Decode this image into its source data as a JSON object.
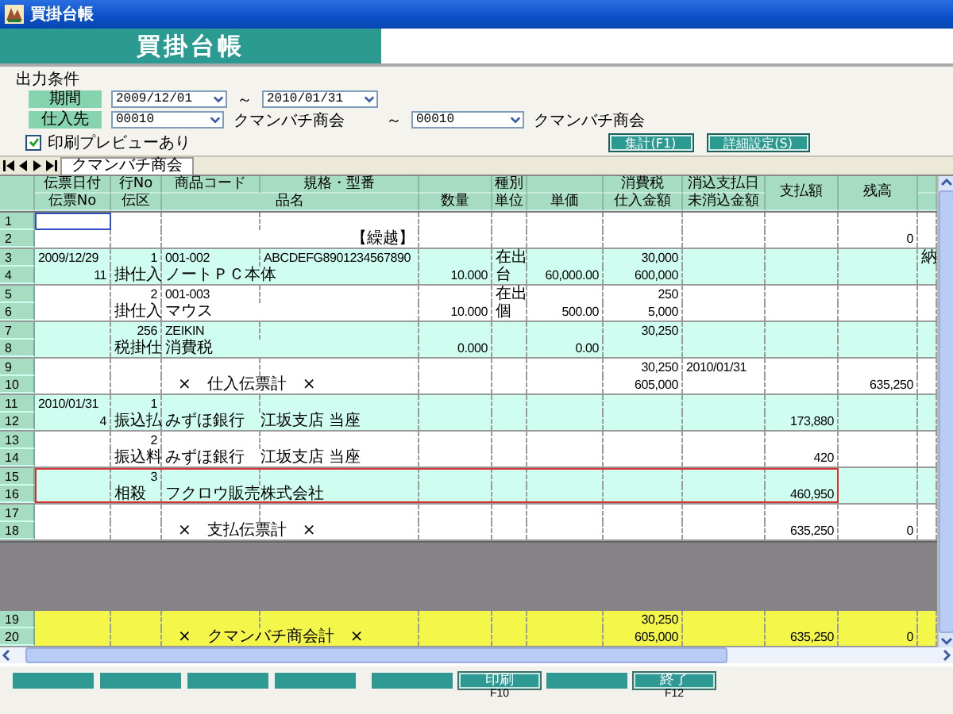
{
  "window": {
    "title": "買掛台帳"
  },
  "header": {
    "title": "買掛台帳"
  },
  "conditions": {
    "title": "出力条件",
    "period": {
      "label": "期間",
      "from": "2009/12/01",
      "separator": "～",
      "to": "2010/01/31"
    },
    "supplier": {
      "label": "仕入先",
      "from_code": "00010",
      "from_name": "クマンバチ商会",
      "separator": "～",
      "to_code": "00010",
      "to_name": "クマンバチ商会"
    },
    "preview": {
      "label": "印刷プレビューあり",
      "checked": true
    },
    "buttons": [
      "集計(F1)",
      "詳細設定(S)"
    ]
  },
  "tabs": [
    {
      "label": "クマンバチ商会",
      "selected": true
    }
  ],
  "table": {
    "header_top": {
      "date": "伝票日付",
      "line_no": "行No",
      "code": "商品コード",
      "spec": "規格・型番",
      "kind": "種別",
      "tax": "消費税",
      "pay_date": "消込支払日",
      "payment": "支払額",
      "balance": "残高"
    },
    "header_bottom": {
      "slip_no": "伝票No",
      "category": "伝区",
      "name": "品名",
      "quantity": "数量",
      "unit": "単位",
      "unit_price": "単価",
      "purchase_amount": "仕入金額",
      "unreconciled": "未消込金額"
    },
    "records": [
      {
        "kind": "carryover",
        "rows": [
          "1",
          "2"
        ],
        "cursor": true,
        "selected": false,
        "bottom": {
          "name": "【繰越】",
          "balance": "0"
        }
      },
      {
        "kind": "item",
        "rows": [
          "3",
          "4"
        ],
        "cursor": false,
        "selected": false,
        "top": {
          "date": "2009/12/29",
          "line_no": "1",
          "code": "001-002",
          "spec": "ABCDEFG8901234567890",
          "kind": "在出",
          "tax": "30,000",
          "extra": "納"
        },
        "bottom": {
          "slip_no": "11",
          "category": "掛仕入",
          "name": "ノートＰＣ本体",
          "quantity": "10.000",
          "unit": "台",
          "unit_price": "60,000.00",
          "purchase_amount": "600,000"
        }
      },
      {
        "kind": "item",
        "rows": [
          "5",
          "6"
        ],
        "cursor": false,
        "selected": false,
        "top": {
          "line_no": "2",
          "code": "001-003",
          "kind": "在出",
          "tax": "250"
        },
        "bottom": {
          "category": "掛仕入",
          "name": "マウス",
          "quantity": "10.000",
          "unit": "個",
          "unit_price": "500.00",
          "purchase_amount": "5,000"
        }
      },
      {
        "kind": "item",
        "rows": [
          "7",
          "8"
        ],
        "cursor": false,
        "selected": false,
        "top": {
          "line_no": "256",
          "code": "ZEIKIN",
          "tax": "30,250"
        },
        "bottom": {
          "category": "税掛仕",
          "name": "消費税",
          "quantity": "0.000",
          "unit_price": "0.00"
        }
      },
      {
        "kind": "subtotal",
        "rows": [
          "9",
          "10"
        ],
        "cursor": false,
        "selected": false,
        "top": {
          "tax": "30,250",
          "pay_date": "2010/01/31"
        },
        "bottom": {
          "name": "×　仕入伝票計　×",
          "purchase_amount": "605,000",
          "balance": "635,250"
        }
      },
      {
        "kind": "item",
        "rows": [
          "11",
          "12"
        ],
        "cursor": false,
        "selected": false,
        "top": {
          "date": "2010/01/31",
          "line_no": "1"
        },
        "bottom": {
          "slip_no": "4",
          "category": "振込払",
          "name": "みずほ銀行　江坂支店 当座",
          "payment": "173,880"
        }
      },
      {
        "kind": "item",
        "rows": [
          "13",
          "14"
        ],
        "cursor": false,
        "selected": false,
        "top": {
          "line_no": "2"
        },
        "bottom": {
          "category": "振込料",
          "name": "みずほ銀行　江坂支店 当座",
          "payment": "420"
        }
      },
      {
        "kind": "item",
        "rows": [
          "15",
          "16"
        ],
        "cursor": false,
        "selected": true,
        "top": {
          "line_no": "3"
        },
        "bottom": {
          "category": "相殺",
          "name": "フクロウ販売株式会社",
          "payment": "460,950"
        }
      },
      {
        "kind": "subtotal",
        "rows": [
          "17",
          "18"
        ],
        "cursor": false,
        "selected": false,
        "bottom": {
          "name": "×　支払伝票計　×",
          "payment": "635,250",
          "balance": "0"
        }
      }
    ],
    "totals": {
      "kind": "subtotal",
      "rows": [
        "19",
        "20"
      ],
      "top": {
        "tax": "30,250"
      },
      "bottom": {
        "name": "×　クマンバチ商会計　×",
        "purchase_amount": "605,000",
        "payment": "635,250",
        "balance": "0"
      }
    }
  },
  "function_keys": [
    [
      {
        "kind": "blank"
      },
      {
        "kind": "blank"
      },
      {
        "kind": "blank"
      },
      {
        "kind": "blank"
      }
    ],
    [
      {
        "kind": "blank"
      },
      {
        "kind": "labeled",
        "label": "印刷",
        "key": "F10"
      },
      {
        "kind": "blank"
      },
      {
        "kind": "labeled",
        "label": "終了",
        "key": "F12"
      }
    ]
  ]
}
